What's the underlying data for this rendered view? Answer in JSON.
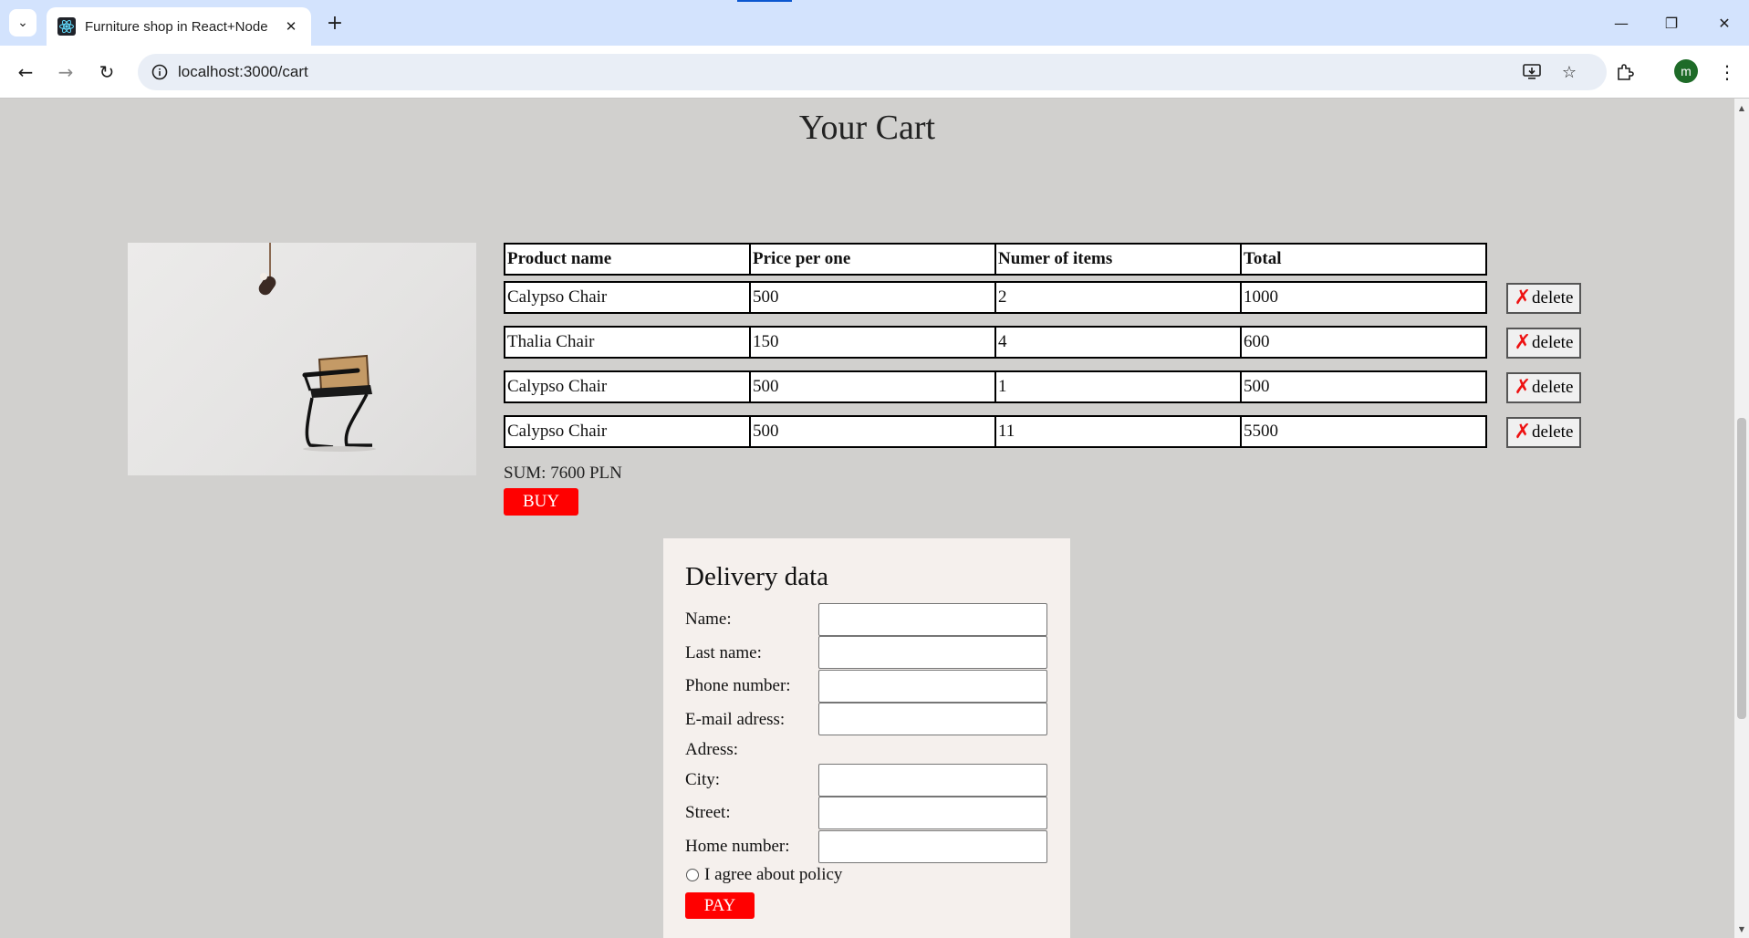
{
  "browser": {
    "tab_title": "Furniture shop in React+Node",
    "url": "localhost:3000/cart",
    "profile_initial": "m"
  },
  "page": {
    "title": "Your Cart",
    "sum_label": "SUM: 7600 PLN",
    "buy_label": "BUY"
  },
  "cart": {
    "headers": [
      "Product name",
      "Price per one",
      "Numer of items",
      "Total"
    ],
    "rows": [
      {
        "name": "Calypso Chair",
        "price": "500",
        "qty": "2",
        "total": "1000"
      },
      {
        "name": "Thalia Chair",
        "price": "150",
        "qty": "4",
        "total": "600"
      },
      {
        "name": "Calypso Chair",
        "price": "500",
        "qty": "1",
        "total": "500"
      },
      {
        "name": "Calypso Chair",
        "price": "500",
        "qty": "11",
        "total": "5500"
      }
    ],
    "delete_label": "delete"
  },
  "delivery": {
    "title": "Delivery data",
    "name_label": "Name:",
    "last_name_label": "Last name:",
    "phone_label": "Phone number:",
    "email_label": "E-mail adress:",
    "address_label": "Adress:",
    "city_label": "City:",
    "street_label": "Street:",
    "home_label": "Home number:",
    "policy_label": "I agree about policy",
    "pay_label": "PAY"
  },
  "colors": {
    "accent_red": "#ff0000",
    "page_bg": "#d1d0ce",
    "panel_bg": "#f5f0ed"
  }
}
